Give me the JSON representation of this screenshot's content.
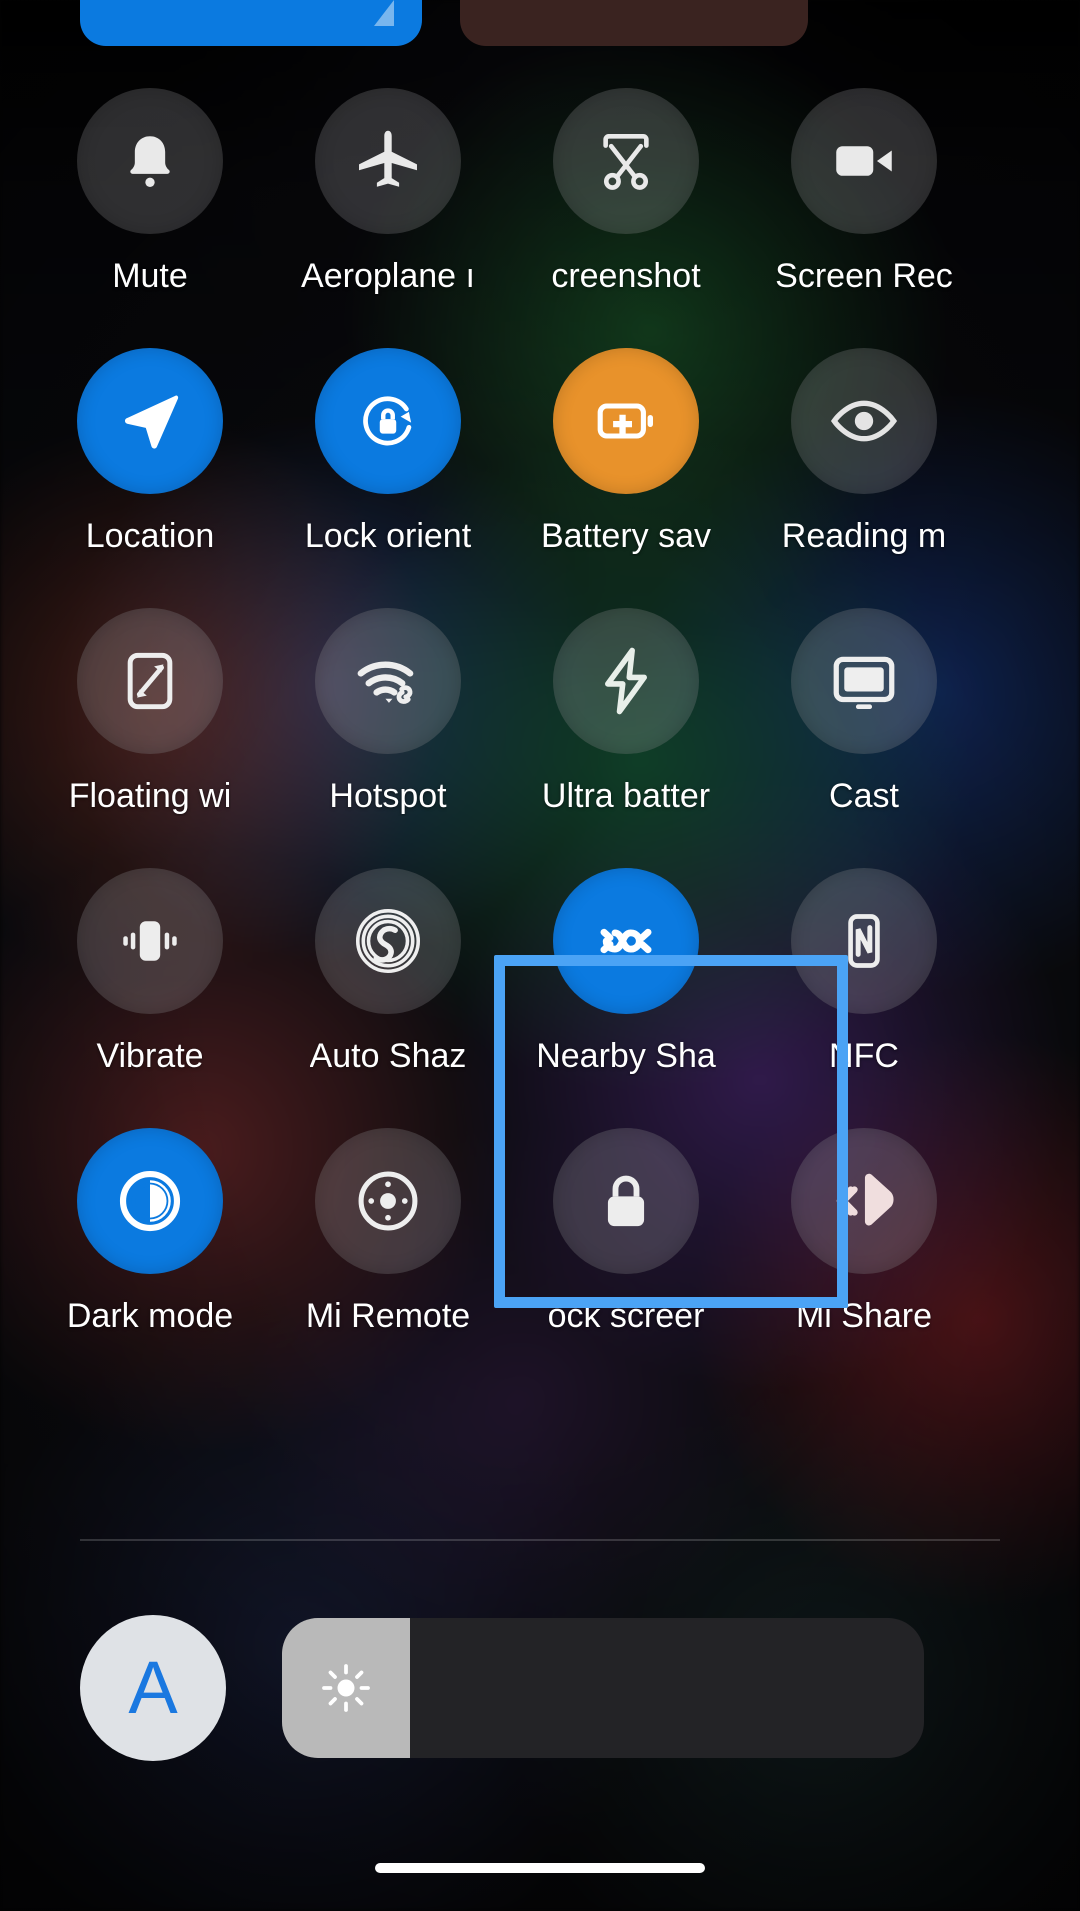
{
  "screen": {
    "name": "android-control-center",
    "accent_blue": "#0b7ae0",
    "accent_orange": "#e8922b",
    "highlight_color": "#4ba3f5",
    "inactive_tile": "rgba(200,200,205,0.22)"
  },
  "top_tiles": [
    {
      "name": "wifi-tile",
      "state": "on",
      "color": "#0b7ae0"
    },
    {
      "name": "bluetooth-tile",
      "state": "off",
      "color": "#3a2320"
    }
  ],
  "quick_settings": {
    "rows": [
      {
        "tiles": [
          {
            "label": "Mute",
            "icon": "bell-icon",
            "active": false
          },
          {
            "label": "Aeroplane ı",
            "icon": "airplane-icon",
            "active": false
          },
          {
            "label": "creenshot",
            "icon": "screenshot-scissors-icon",
            "active": false
          },
          {
            "label": "Screen Rec",
            "icon": "screen-record-icon",
            "active": false
          }
        ]
      },
      {
        "tiles": [
          {
            "label": "Location",
            "icon": "location-arrow-icon",
            "active": true
          },
          {
            "label": "Lock orient",
            "icon": "lock-rotation-icon",
            "active": true
          },
          {
            "label": "Battery sav",
            "icon": "battery-saver-icon",
            "active": true,
            "accent": "orange"
          },
          {
            "label": "Reading m",
            "icon": "eye-icon",
            "active": false
          }
        ]
      },
      {
        "tiles": [
          {
            "label": "Floating wi",
            "icon": "floating-window-icon",
            "active": false
          },
          {
            "label": "Hotspot",
            "icon": "hotspot-icon",
            "active": false
          },
          {
            "label": "Ultra batter",
            "icon": "lightning-bolt-icon",
            "active": false
          },
          {
            "label": "Cast",
            "icon": "cast-monitor-icon",
            "active": false
          }
        ]
      },
      {
        "tiles": [
          {
            "label": "Vibrate",
            "icon": "vibrate-icon",
            "active": false
          },
          {
            "label": "Auto Shaz",
            "icon": "shazam-icon",
            "active": false
          },
          {
            "label": "Nearby Sha",
            "icon": "nearby-share-icon",
            "active": true,
            "selected": true
          },
          {
            "label": "NFC",
            "icon": "nfc-icon",
            "active": false
          }
        ]
      },
      {
        "tiles": [
          {
            "label": "Dark mode",
            "icon": "dark-mode-icon",
            "active": true
          },
          {
            "label": "Mi Remote",
            "icon": "mi-remote-icon",
            "active": false
          },
          {
            "label": "ock screer",
            "icon": "lock-screen-icon",
            "active": false
          },
          {
            "label": "Mi Share",
            "icon": "mi-share-icon",
            "active": false
          }
        ]
      }
    ]
  },
  "brightness": {
    "auto_label": "A",
    "auto_name": "auto-brightness-button",
    "slider_icon": "brightness-sun-icon",
    "fill_percent": "20%"
  }
}
